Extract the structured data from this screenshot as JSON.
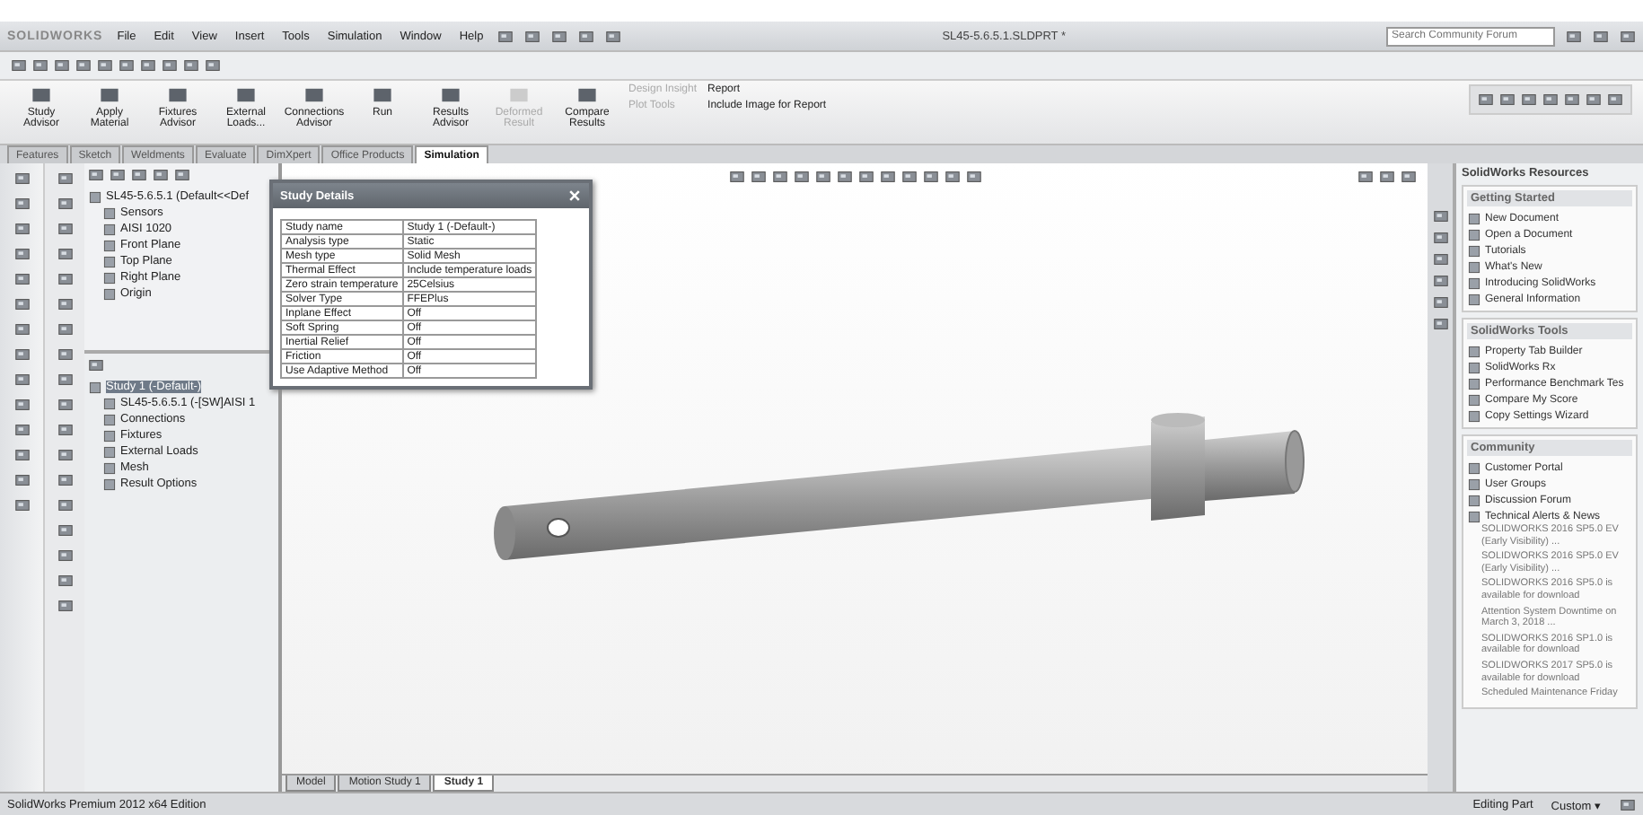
{
  "app": {
    "logo": "SOLIDWORKS",
    "menu": [
      "File",
      "Edit",
      "View",
      "Insert",
      "Tools",
      "Simulation",
      "Window",
      "Help"
    ],
    "title": "SL45-5.6.5.1.SLDPRT *",
    "search": {
      "placeholder": "Search Community Forum"
    }
  },
  "ribbon": {
    "buttons": [
      {
        "label": "Study Advisor",
        "disabled": false
      },
      {
        "label": "Apply Material",
        "disabled": false
      },
      {
        "label": "Fixtures Advisor",
        "disabled": false
      },
      {
        "label": "External Loads...",
        "disabled": false
      },
      {
        "label": "Connections Advisor",
        "disabled": false
      },
      {
        "label": "Run",
        "disabled": false
      },
      {
        "label": "Results Advisor",
        "disabled": false
      },
      {
        "label": "Deformed Result",
        "disabled": true
      },
      {
        "label": "Compare Results",
        "disabled": false
      }
    ],
    "small_buttons": [
      {
        "label": "Design Insight",
        "disabled": true
      },
      {
        "label": "Plot Tools",
        "disabled": true
      }
    ],
    "report_buttons": [
      {
        "label": "Report"
      },
      {
        "label": "Include Image for Report"
      }
    ]
  },
  "tabs": [
    {
      "label": "Features",
      "selected": false
    },
    {
      "label": "Sketch",
      "selected": false
    },
    {
      "label": "Weldments",
      "selected": false
    },
    {
      "label": "Evaluate",
      "selected": false
    },
    {
      "label": "DimXpert",
      "selected": false
    },
    {
      "label": "Office Products",
      "selected": false
    },
    {
      "label": "Simulation",
      "selected": true
    }
  ],
  "feature_tree": {
    "root": "SL45-5.6.5.1  (Default<<Def",
    "items": [
      "Sensors",
      "AISI 1020",
      "Front Plane",
      "Top Plane",
      "Right Plane",
      "Origin"
    ]
  },
  "study_tree": {
    "root": {
      "label": "Study 1 (-Default-)",
      "selected": true
    },
    "items": [
      "SL45-5.6.5.1 (-[SW]AISI 1",
      "Connections",
      "Fixtures",
      "External Loads",
      "Mesh",
      "Result Options"
    ]
  },
  "study_details": {
    "title": "Study Details",
    "rows": [
      {
        "name": "Study name",
        "value": "Study 1 (-Default-)"
      },
      {
        "name": "Analysis type",
        "value": "Static"
      },
      {
        "name": "Mesh type",
        "value": "Solid Mesh"
      },
      {
        "name": "Thermal Effect",
        "value": "Include temperature loads"
      },
      {
        "name": "Zero strain temperature",
        "value": "25Celsius"
      },
      {
        "name": "Solver Type",
        "value": "FFEPlus"
      },
      {
        "name": "Inplane Effect",
        "value": "Off"
      },
      {
        "name": "Soft Spring",
        "value": "Off"
      },
      {
        "name": "Inertial Relief",
        "value": "Off"
      },
      {
        "name": "Friction",
        "value": "Off"
      },
      {
        "name": "Use Adaptive Method",
        "value": "Off"
      }
    ]
  },
  "bottom_tabs": [
    {
      "label": "Model",
      "selected": false
    },
    {
      "label": "Motion Study 1",
      "selected": false
    },
    {
      "label": "Study 1",
      "selected": true
    }
  ],
  "task_pane": {
    "title": "SolidWorks Resources",
    "sections": [
      {
        "title": "Getting Started",
        "items": [
          "New Document",
          "Open a Document",
          "Tutorials",
          "What's New",
          "Introducing SolidWorks",
          "General Information"
        ]
      },
      {
        "title": "SolidWorks Tools",
        "items": [
          "Property Tab Builder",
          "SolidWorks Rx",
          "Performance Benchmark Tes",
          "Compare My Score",
          "Copy Settings Wizard"
        ]
      },
      {
        "title": "Community",
        "items": [
          "Customer Portal",
          "User Groups",
          "Discussion Forum",
          "Technical Alerts & News"
        ]
      }
    ],
    "news": [
      "SOLIDWORKS 2016 SP5.0 EV (Early Visibility) ...",
      "SOLIDWORKS 2016 SP5.0 EV (Early Visibility) ...",
      "SOLIDWORKS 2016 SP5.0 is available for download",
      "Attention System Downtime on March 3, 2018 ...",
      "SOLIDWORKS 2016 SP1.0 is available for download",
      "SOLIDWORKS 2017 SP5.0 is available for download",
      "Scheduled Maintenance Friday"
    ]
  },
  "status_bar": {
    "product": "SolidWorks Premium 2012 x64 Edition",
    "mode": "Editing Part",
    "units": "Custom ▾"
  }
}
